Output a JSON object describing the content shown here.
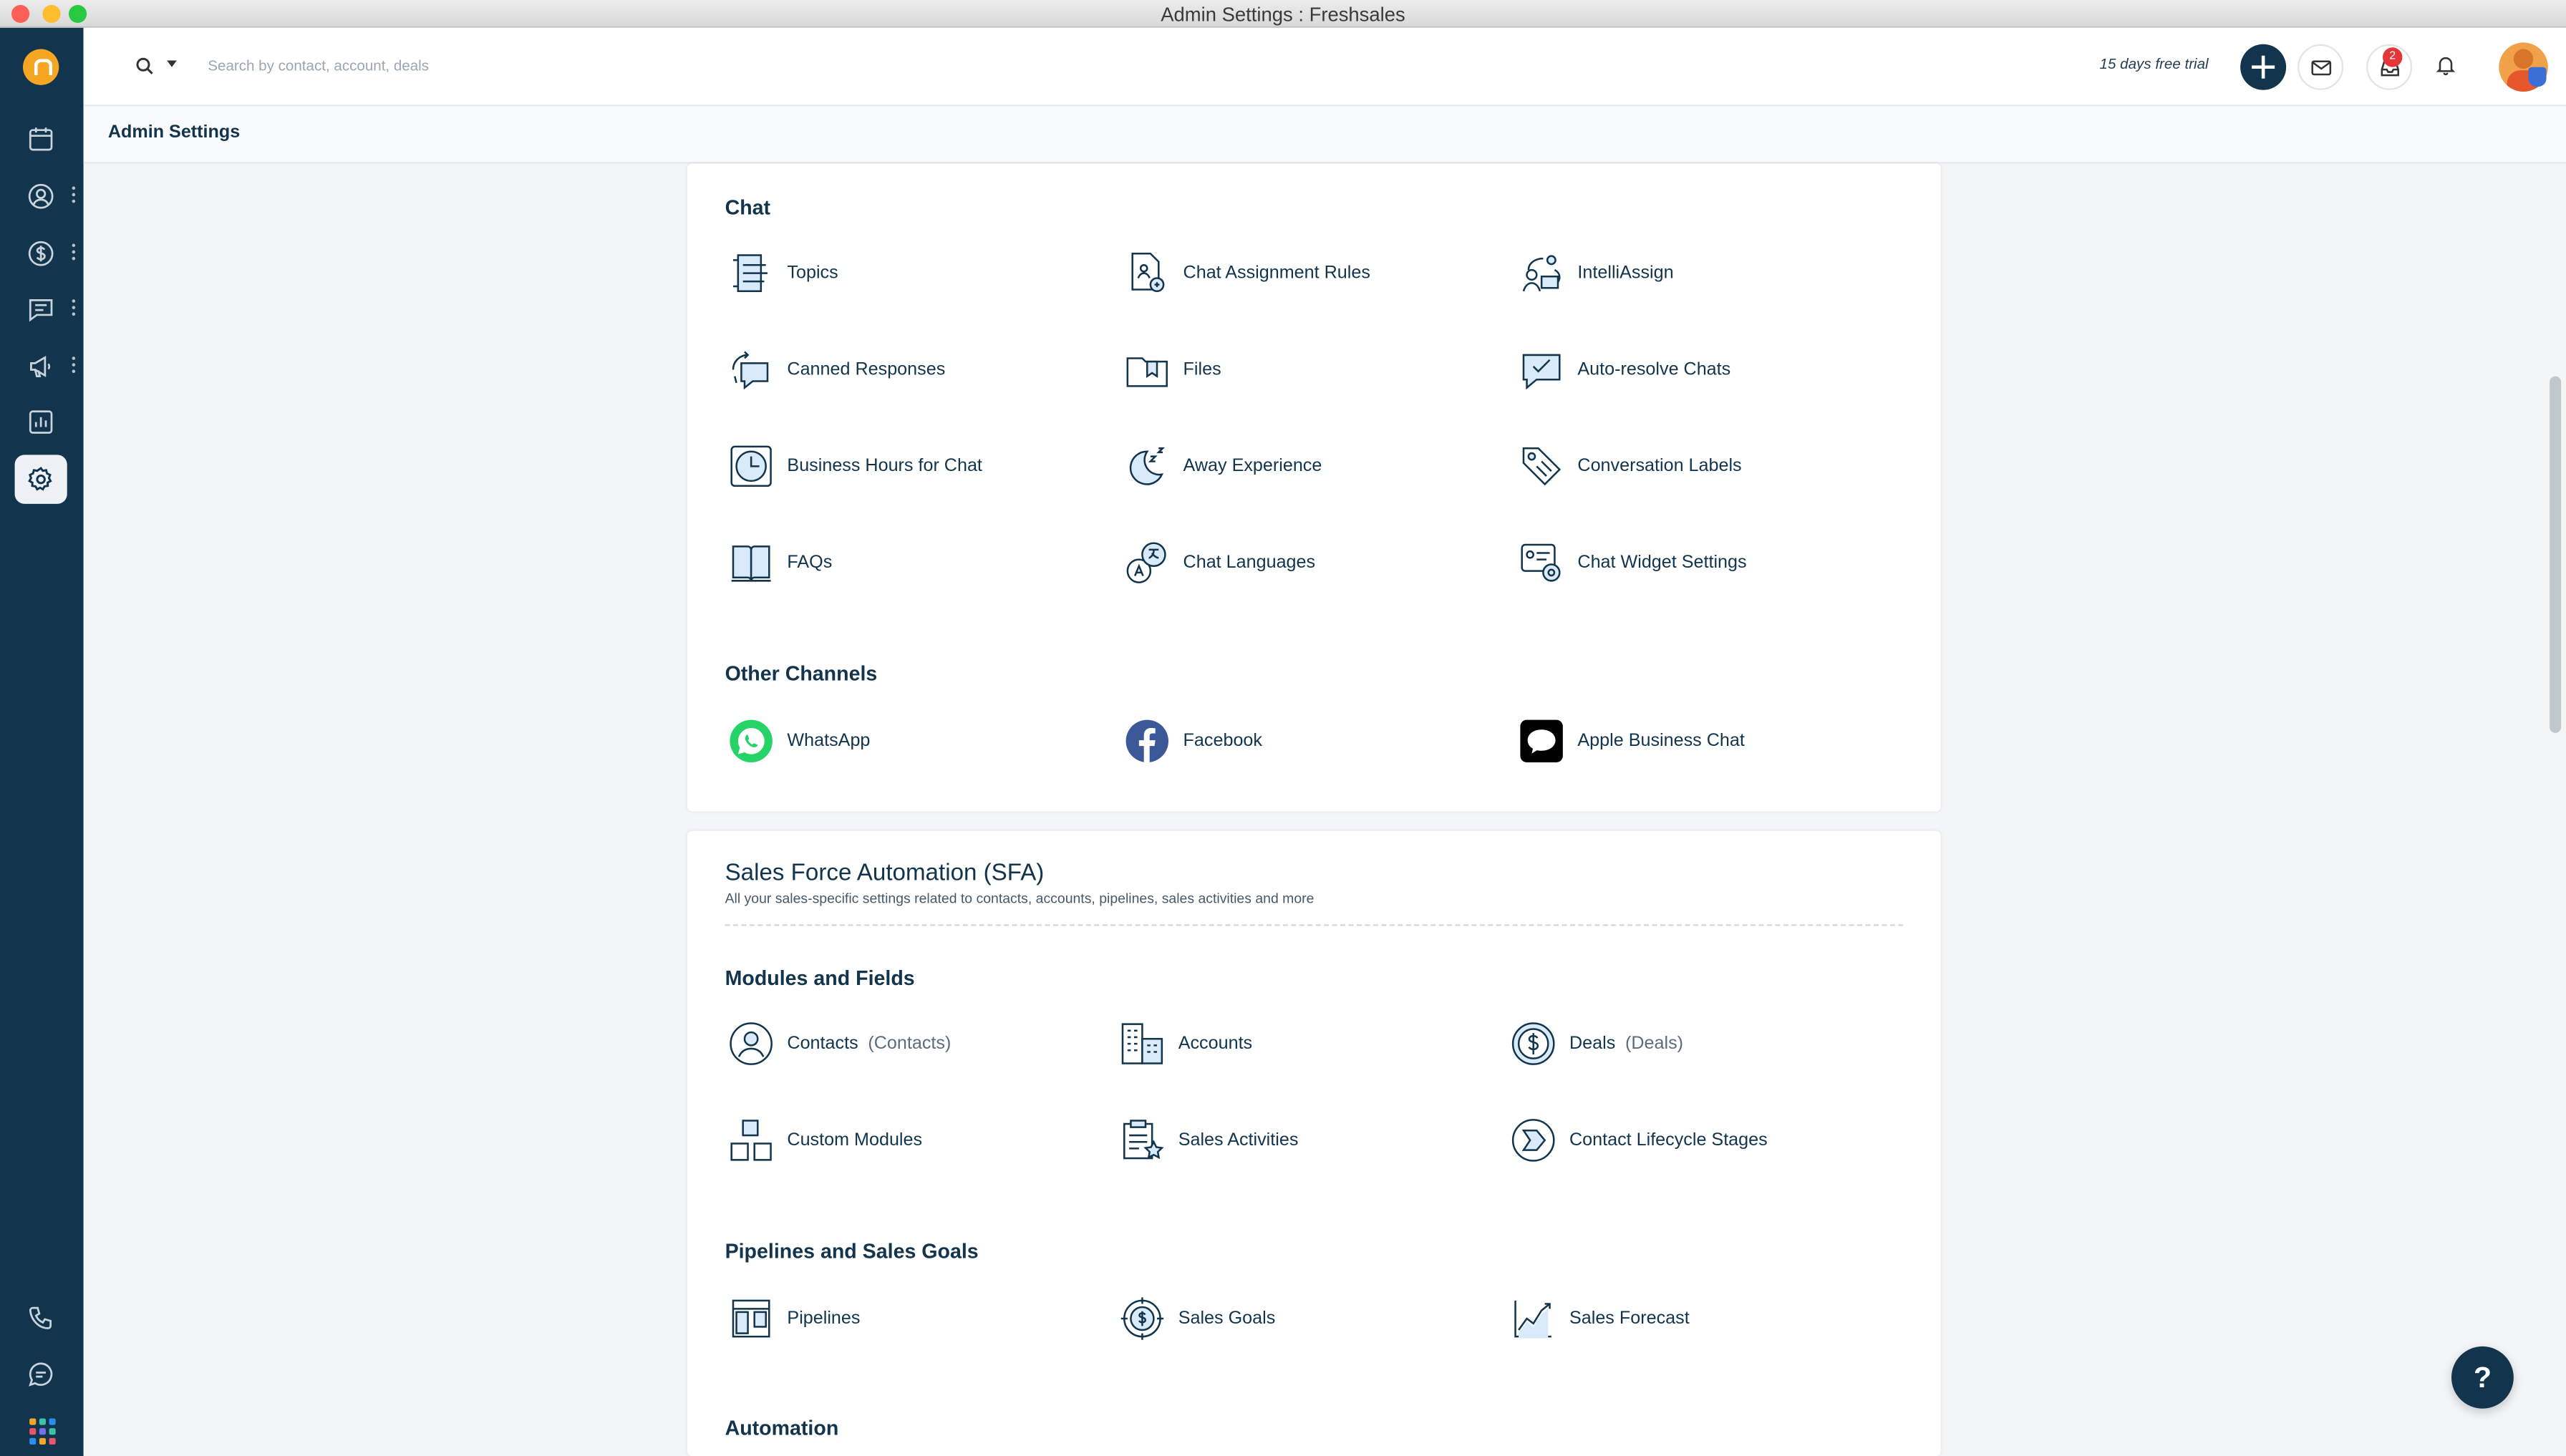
{
  "window": {
    "title": "Admin Settings : Freshsales"
  },
  "topbar": {
    "search_placeholder": "Search by contact, account, deals",
    "trial_text": "15 days free trial",
    "notification_count": "2"
  },
  "header": {
    "title": "Admin Settings"
  },
  "chat": {
    "section_title": "Chat",
    "items": [
      {
        "label": "Topics",
        "icon": "topics-icon"
      },
      {
        "label": "Chat Assignment Rules",
        "icon": "chat-assignment-icon"
      },
      {
        "label": "IntelliAssign",
        "icon": "intelliassign-icon"
      },
      {
        "label": "Canned Responses",
        "icon": "canned-responses-icon"
      },
      {
        "label": "Files",
        "icon": "files-icon"
      },
      {
        "label": "Auto-resolve Chats",
        "icon": "auto-resolve-icon"
      },
      {
        "label": "Business Hours for Chat",
        "icon": "clock-icon"
      },
      {
        "label": "Away Experience",
        "icon": "moon-icon"
      },
      {
        "label": "Conversation Labels",
        "icon": "tag-icon"
      },
      {
        "label": "FAQs",
        "icon": "book-icon"
      },
      {
        "label": "Chat Languages",
        "icon": "languages-icon"
      },
      {
        "label": "Chat Widget Settings",
        "icon": "widget-settings-icon"
      }
    ]
  },
  "other_channels": {
    "section_title": "Other Channels",
    "items": [
      {
        "label": "WhatsApp",
        "icon": "whatsapp-icon",
        "color": "#25d366"
      },
      {
        "label": "Facebook",
        "icon": "facebook-icon",
        "color": "#3b5998"
      },
      {
        "label": "Apple Business Chat",
        "icon": "apple-business-chat-icon",
        "color": "#000000"
      }
    ]
  },
  "sfa": {
    "title": "Sales Force Automation (SFA)",
    "subtitle": "All your sales-specific settings related to contacts, accounts, pipelines, sales activities and more",
    "modules_title": "Modules and Fields",
    "modules": [
      {
        "label": "Contacts",
        "suffix": "(Contacts)",
        "icon": "contact-icon"
      },
      {
        "label": "Accounts",
        "suffix": "",
        "icon": "accounts-icon"
      },
      {
        "label": "Deals",
        "suffix": "(Deals)",
        "icon": "deals-icon"
      },
      {
        "label": "Custom Modules",
        "suffix": "",
        "icon": "custom-modules-icon"
      },
      {
        "label": "Sales Activities",
        "suffix": "",
        "icon": "sales-activities-icon"
      },
      {
        "label": "Contact Lifecycle Stages",
        "suffix": "",
        "icon": "lifecycle-icon"
      }
    ],
    "pipelines_title": "Pipelines and Sales Goals",
    "pipelines": [
      {
        "label": "Pipelines",
        "icon": "pipelines-icon"
      },
      {
        "label": "Sales Goals",
        "icon": "sales-goals-icon"
      },
      {
        "label": "Sales Forecast",
        "icon": "sales-forecast-icon"
      }
    ],
    "automation_title": "Automation"
  },
  "help": {
    "label": "?"
  },
  "colors": {
    "sidebar": "#12344d",
    "accent": "#12344d",
    "badge": "#e43538"
  }
}
